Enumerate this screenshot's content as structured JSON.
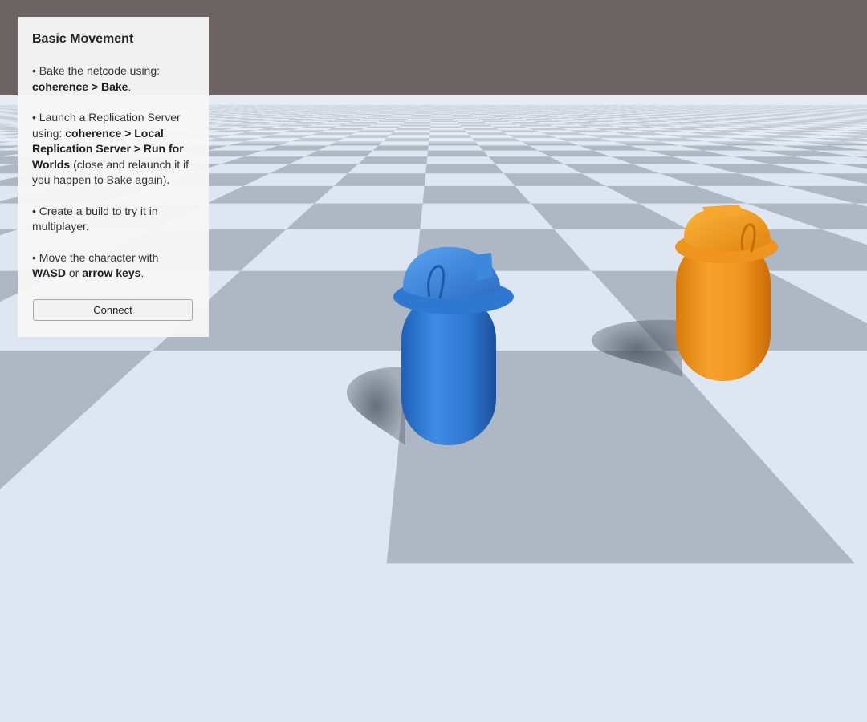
{
  "panel": {
    "title": "Basic Movement",
    "p1": {
      "t1": "• Bake the netcode using: ",
      "b1": "coherence > Bake",
      "t2": "."
    },
    "p2": {
      "t1": "• Launch a Replication Server using: ",
      "b1": "coherence > Local Replication Server > Run for Worlds",
      "t2": " (close and relaunch it if you happen to Bake again)."
    },
    "p3": {
      "t1": "• Create a build to try it in multiplayer."
    },
    "p4": {
      "t1": "• Move the character with ",
      "b1": "WASD",
      "t2": " or ",
      "b2": "arrow keys",
      "t3": "."
    },
    "connect_label": "Connect"
  },
  "scene": {
    "sky_color": "#6b6462",
    "floor_light": "#dde6f1",
    "floor_dark": "#aeb8c4",
    "players": [
      {
        "name": "blue-player",
        "color": "#3a85db"
      },
      {
        "name": "orange-player",
        "color": "#f49a21"
      }
    ]
  }
}
